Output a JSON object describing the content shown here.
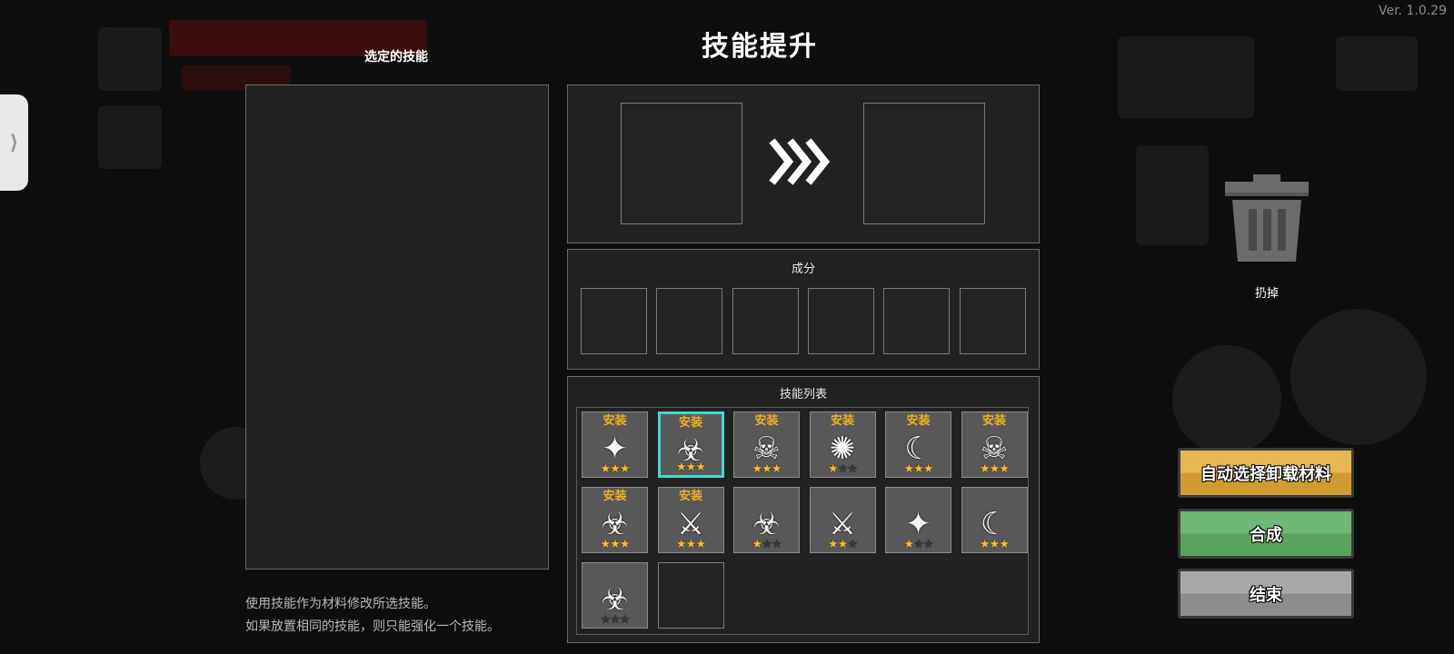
{
  "version": "Ver. 1.0.29",
  "side_tab": {
    "icon": "chevron-right-icon",
    "glyph": "⟩"
  },
  "title": "技能提升",
  "selected_panel": {
    "label": "选定的技能"
  },
  "materials": {
    "label": "成分"
  },
  "skill_list": {
    "label": "技能列表",
    "equip_text": "安装",
    "skills": [
      {
        "icon": "shuriken-chain-icon",
        "glyph": "✦",
        "stars": 3,
        "equipped": true,
        "selected": false
      },
      {
        "icon": "biohazard-icon",
        "glyph": "☣",
        "stars": 3,
        "equipped": true,
        "selected": true
      },
      {
        "icon": "skull-burst-icon",
        "glyph": "☠",
        "stars": 3,
        "equipped": true,
        "selected": false
      },
      {
        "icon": "explosion-icon",
        "glyph": "✺",
        "stars": 1,
        "equipped": true,
        "selected": false
      },
      {
        "icon": "crescent-moon-icon",
        "glyph": "☾",
        "stars": 3,
        "equipped": true,
        "selected": false
      },
      {
        "icon": "skull-burst-icon",
        "glyph": "☠",
        "stars": 3,
        "equipped": true,
        "selected": false
      },
      {
        "icon": "winged-biohazard-icon",
        "glyph": "☣",
        "stars": 3,
        "equipped": true,
        "selected": false
      },
      {
        "icon": "sword-icon",
        "glyph": "⚔",
        "stars": 3,
        "equipped": true,
        "selected": false
      },
      {
        "icon": "winged-biohazard-icon",
        "glyph": "☣",
        "stars": 1,
        "equipped": false,
        "selected": false
      },
      {
        "icon": "sword-icon",
        "glyph": "⚔",
        "stars": 2,
        "equipped": false,
        "selected": false
      },
      {
        "icon": "shuriken-chain-icon",
        "glyph": "✦",
        "stars": 1,
        "equipped": false,
        "selected": false
      },
      {
        "icon": "crescent-moon-icon",
        "glyph": "☾",
        "stars": 3,
        "equipped": false,
        "selected": false
      },
      {
        "icon": "biohazard-icon",
        "glyph": "☣",
        "stars": 0,
        "equipped": false,
        "selected": false
      },
      {
        "empty": true
      }
    ]
  },
  "description": {
    "line1": "使用技能作为材料修改所选技能。",
    "line2": "如果放置相同的技能，则只能强化一个技能。"
  },
  "trash": {
    "label": "扔掉"
  },
  "buttons": {
    "auto_select": "自动选择卸载材料",
    "merge": "合成",
    "end": "结束"
  },
  "colors": {
    "star": "#ffb82e",
    "equip": "#f0b020",
    "selected_border": "#42d8d0",
    "auto_button": "#e8b850",
    "merge_button": "#6db873",
    "end_button": "#a9a9a9"
  }
}
